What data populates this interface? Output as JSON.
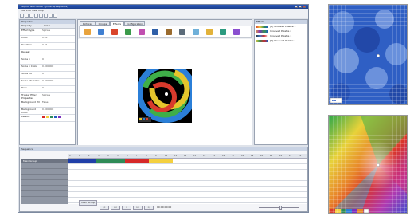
{
  "window": {
    "title": "xLights Nutcracker - [Effects/Sequence]"
  },
  "menu": [
    "File",
    "Edit",
    "View",
    "Help"
  ],
  "properties": {
    "title": "Properties",
    "columns": [
      "Property",
      "Value"
    ],
    "rows": [
      {
        "k": "Effect type",
        "v": "Spirals"
      },
      {
        "k": "Color",
        "v": "0.01"
      },
      {
        "k": "Duration",
        "v": "0.01"
      },
      {
        "k": "Repeat",
        "v": ""
      },
      {
        "k": "Scale x",
        "v": "0"
      },
      {
        "k": "Scale x Color",
        "v": "0.000000"
      },
      {
        "k": "Scale Ctr",
        "v": "0"
      },
      {
        "k": "Scale Ctr Color",
        "v": "0.000000"
      },
      {
        "k": "Rate",
        "v": "0"
      },
      {
        "k": "Trigger Effect Properties",
        "v": "Spirals"
      },
      {
        "k": "Background Fill",
        "v": "False"
      },
      {
        "k": "Background Color",
        "v": "0.000000"
      },
      {
        "k": "Palette",
        "v": ""
      }
    ],
    "palette": [
      "#d62828",
      "#f4d03f",
      "#2e8b57",
      "#1f5fbf",
      "#7b2fbe"
    ]
  },
  "tabs": [
    "Pictures",
    "Groups",
    "Effects",
    "Configuration"
  ],
  "active_tab": "Effects",
  "effect_icons": [
    {
      "name": "color-wash-icon",
      "color": "#e8a33d"
    },
    {
      "name": "spirals-icon",
      "color": "#3f7fd1"
    },
    {
      "name": "fire-icon",
      "color": "#d9452b"
    },
    {
      "name": "tree-icon",
      "color": "#3a9a4a"
    },
    {
      "name": "butterfly-icon",
      "color": "#c04fb0"
    },
    {
      "name": "bars-icon",
      "color": "#2f5fa8"
    },
    {
      "name": "circles-icon",
      "color": "#9a6b2f"
    },
    {
      "name": "meteor-icon",
      "color": "#5b6b7a"
    },
    {
      "name": "snowflake-icon",
      "color": "#6fb0d9"
    },
    {
      "name": "text-icon",
      "color": "#e2b23a"
    },
    {
      "name": "pinwheel-icon",
      "color": "#2b9a80"
    },
    {
      "name": "picture-icon",
      "color": "#8a4fd0"
    }
  ],
  "effects_panel": {
    "title": "Effects",
    "rows": [
      {
        "name": "[1] Unsaved Palette 1",
        "colors": [
          "#d62828",
          "#f4d03f",
          "#2e8b57",
          "#1f5fbf"
        ]
      },
      {
        "name": "Unsaved Palette 2",
        "colors": [
          "#e8a33d",
          "#7b2fbe",
          "#3a9a4a",
          "#1f5fbf"
        ]
      },
      {
        "name": "Unsaved Palette 3",
        "colors": [
          "#222222",
          "#3f7fd1",
          "#d62828",
          "#ffffff"
        ]
      },
      {
        "name": "[4] Unsaved Palette 4",
        "colors": [
          "#f4d03f",
          "#2e8b57",
          "#d62828",
          "#1f5fbf"
        ]
      }
    ]
  },
  "sequence": {
    "title": "Sequence",
    "rows": [
      "Main Group",
      "",
      "",
      "",
      "",
      "",
      "",
      ""
    ],
    "ticks": [
      "0",
      "1",
      "2",
      "3",
      "4",
      "5",
      "6",
      "7",
      "8",
      "9",
      "10",
      "11",
      "12",
      "13",
      "14",
      "15",
      "16",
      "17",
      "18",
      "19",
      "20",
      "21",
      "22",
      "23",
      "24"
    ],
    "blocks": [
      {
        "color": "#1f3fa8",
        "start": 0,
        "end": 3.0
      },
      {
        "color": "#2e8b57",
        "start": 3.0,
        "end": 6.0
      },
      {
        "color": "#d62828",
        "start": 6.0,
        "end": 8.5
      },
      {
        "color": "#f4d03f",
        "start": 8.5,
        "end": 11.0
      }
    ],
    "transport": [
      "|<",
      "<<",
      ">",
      ">>",
      ">|"
    ],
    "time": "00:00:00:00",
    "status": "Main Group"
  }
}
